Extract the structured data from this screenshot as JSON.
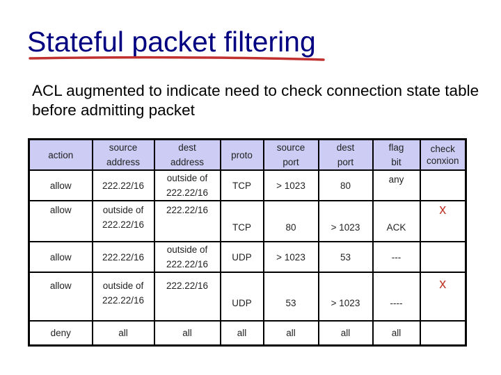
{
  "slide": {
    "title": "Stateful packet filtering",
    "subtitle": "ACL augmented to indicate need to check connection state table before admitting packet",
    "colors": {
      "title": "#000080",
      "underline": "#c0302f",
      "header_bg": "#ccccf5",
      "check_mark": "#c0392b"
    }
  },
  "table": {
    "headers": [
      {
        "line1": "action",
        "line2": ""
      },
      {
        "line1": "source",
        "line2": "address"
      },
      {
        "line1": "dest",
        "line2": "address"
      },
      {
        "line1": "proto",
        "line2": ""
      },
      {
        "line1": "source",
        "line2": "port"
      },
      {
        "line1": "dest",
        "line2": "port"
      },
      {
        "line1": "flag",
        "line2": "bit"
      },
      {
        "line1": "check",
        "line2": "conxion"
      }
    ],
    "rows": [
      {
        "action": "allow",
        "src_a": "222.22/16",
        "src_b": "",
        "dst_a": "outside of",
        "dst_b": "222.22/16",
        "proto": "TCP",
        "sport": "> 1023",
        "dport": "80",
        "flag": "any",
        "check": ""
      },
      {
        "action": "allow",
        "src_a": "outside of",
        "src_b": "222.22/16",
        "dst_a": "222.22/16",
        "dst_b": "",
        "proto": "TCP",
        "sport": "80",
        "dport": "> 1023",
        "flag": "ACK",
        "check": "x"
      },
      {
        "action": "allow",
        "src_a": "222.22/16",
        "src_b": "",
        "dst_a": "outside of",
        "dst_b": "222.22/16",
        "proto": "UDP",
        "sport": "> 1023",
        "dport": "53",
        "flag": "---",
        "check": ""
      },
      {
        "action": "allow",
        "src_a": "outside of",
        "src_b": "222.22/16",
        "dst_a": "222.22/16",
        "dst_b": "",
        "proto": "UDP",
        "sport": "53",
        "dport": "> 1023",
        "flag": "----",
        "check": "x"
      },
      {
        "action": "deny",
        "src_a": "all",
        "src_b": "",
        "dst_a": "all",
        "dst_b": "",
        "proto": "all",
        "sport": "all",
        "dport": "all",
        "flag": "all",
        "check": ""
      }
    ]
  }
}
